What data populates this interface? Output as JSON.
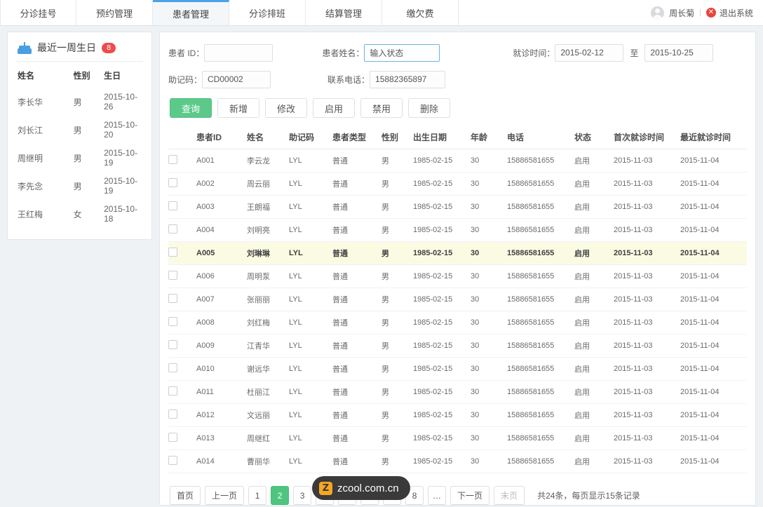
{
  "topbar": {
    "tabs": [
      {
        "label": "分诊挂号",
        "active": false
      },
      {
        "label": "预约管理",
        "active": false
      },
      {
        "label": "患者管理",
        "active": true
      },
      {
        "label": "分诊排班",
        "active": false
      },
      {
        "label": "结算管理",
        "active": false
      },
      {
        "label": "缴欠费",
        "active": false
      }
    ],
    "user_name": "周长菊",
    "divider": "|",
    "logout_label": "退出系统",
    "logout_icon_glyph": "✕",
    "avatar_icon": "user-avatar-icon"
  },
  "sidebar": {
    "title": "最近一周生日",
    "badge": "8",
    "icon": "birthday-cake-icon",
    "columns": [
      "姓名",
      "性别",
      "生日"
    ],
    "rows": [
      {
        "name": "李长华",
        "gender": "男",
        "birthday": "2015-10-26"
      },
      {
        "name": "刘长江",
        "gender": "男",
        "birthday": "2015-10-20"
      },
      {
        "name": "周继明",
        "gender": "男",
        "birthday": "2015-10-19"
      },
      {
        "name": "李先念",
        "gender": "男",
        "birthday": "2015-10-19"
      },
      {
        "name": "王红梅",
        "gender": "女",
        "birthday": "2015-10-18"
      }
    ]
  },
  "search": {
    "patient_id_label": "患者 ID：",
    "patient_id_value": "",
    "patient_id_placeholder": "",
    "patient_name_label": "患者姓名：",
    "patient_name_value": "输入状态",
    "visit_time_label": "就诊时间：",
    "visit_date_from": "2015-02-12",
    "visit_range_sep": "至",
    "visit_date_to": "2015-10-25",
    "mnemonic_label": "助记码：",
    "mnemonic_value": "CD00002",
    "phone_label": "联系电话：",
    "phone_value": "15882365897"
  },
  "actions": {
    "query": "查询",
    "add": "新增",
    "edit": "修改",
    "enable": "启用",
    "disable": "禁用",
    "delete": "删除"
  },
  "table": {
    "columns": [
      "患者ID",
      "姓名",
      "助记码",
      "患者类型",
      "性别",
      "出生日期",
      "年龄",
      "电话",
      "状态",
      "首次就诊时间",
      "最近就诊时间"
    ],
    "rows": [
      {
        "id": "A001",
        "name": "李云龙",
        "mnemonic": "LYL",
        "type": "普通",
        "gender": "男",
        "birth": "1985-02-15",
        "age": "30",
        "phone": "15886581655",
        "status": "启用",
        "first_visit": "2015-11-03",
        "last_visit": "2015-11-04",
        "highlight": false
      },
      {
        "id": "A002",
        "name": "周云丽",
        "mnemonic": "LYL",
        "type": "普通",
        "gender": "男",
        "birth": "1985-02-15",
        "age": "30",
        "phone": "15886581655",
        "status": "启用",
        "first_visit": "2015-11-03",
        "last_visit": "2015-11-04",
        "highlight": false
      },
      {
        "id": "A003",
        "name": "王朗福",
        "mnemonic": "LYL",
        "type": "普通",
        "gender": "男",
        "birth": "1985-02-15",
        "age": "30",
        "phone": "15886581655",
        "status": "启用",
        "first_visit": "2015-11-03",
        "last_visit": "2015-11-04",
        "highlight": false
      },
      {
        "id": "A004",
        "name": "刘明亮",
        "mnemonic": "LYL",
        "type": "普通",
        "gender": "男",
        "birth": "1985-02-15",
        "age": "30",
        "phone": "15886581655",
        "status": "启用",
        "first_visit": "2015-11-03",
        "last_visit": "2015-11-04",
        "highlight": false
      },
      {
        "id": "A005",
        "name": "刘琳琳",
        "mnemonic": "LYL",
        "type": "普通",
        "gender": "男",
        "birth": "1985-02-15",
        "age": "30",
        "phone": "15886581655",
        "status": "启用",
        "first_visit": "2015-11-03",
        "last_visit": "2015-11-04",
        "highlight": true
      },
      {
        "id": "A006",
        "name": "周明泵",
        "mnemonic": "LYL",
        "type": "普通",
        "gender": "男",
        "birth": "1985-02-15",
        "age": "30",
        "phone": "15886581655",
        "status": "启用",
        "first_visit": "2015-11-03",
        "last_visit": "2015-11-04",
        "highlight": false
      },
      {
        "id": "A007",
        "name": "张丽丽",
        "mnemonic": "LYL",
        "type": "普通",
        "gender": "男",
        "birth": "1985-02-15",
        "age": "30",
        "phone": "15886581655",
        "status": "启用",
        "first_visit": "2015-11-03",
        "last_visit": "2015-11-04",
        "highlight": false
      },
      {
        "id": "A008",
        "name": "刘红梅",
        "mnemonic": "LYL",
        "type": "普通",
        "gender": "男",
        "birth": "1985-02-15",
        "age": "30",
        "phone": "15886581655",
        "status": "启用",
        "first_visit": "2015-11-03",
        "last_visit": "2015-11-04",
        "highlight": false
      },
      {
        "id": "A009",
        "name": "江青华",
        "mnemonic": "LYL",
        "type": "普通",
        "gender": "男",
        "birth": "1985-02-15",
        "age": "30",
        "phone": "15886581655",
        "status": "启用",
        "first_visit": "2015-11-03",
        "last_visit": "2015-11-04",
        "highlight": false
      },
      {
        "id": "A010",
        "name": "谢远华",
        "mnemonic": "LYL",
        "type": "普通",
        "gender": "男",
        "birth": "1985-02-15",
        "age": "30",
        "phone": "15886581655",
        "status": "启用",
        "first_visit": "2015-11-03",
        "last_visit": "2015-11-04",
        "highlight": false
      },
      {
        "id": "A011",
        "name": "杜丽江",
        "mnemonic": "LYL",
        "type": "普通",
        "gender": "男",
        "birth": "1985-02-15",
        "age": "30",
        "phone": "15886581655",
        "status": "启用",
        "first_visit": "2015-11-03",
        "last_visit": "2015-11-04",
        "highlight": false
      },
      {
        "id": "A012",
        "name": "文远丽",
        "mnemonic": "LYL",
        "type": "普通",
        "gender": "男",
        "birth": "1985-02-15",
        "age": "30",
        "phone": "15886581655",
        "status": "启用",
        "first_visit": "2015-11-03",
        "last_visit": "2015-11-04",
        "highlight": false
      },
      {
        "id": "A013",
        "name": "周继红",
        "mnemonic": "LYL",
        "type": "普通",
        "gender": "男",
        "birth": "1985-02-15",
        "age": "30",
        "phone": "15886581655",
        "status": "启用",
        "first_visit": "2015-11-03",
        "last_visit": "2015-11-04",
        "highlight": false
      },
      {
        "id": "A014",
        "name": "曹丽华",
        "mnemonic": "LYL",
        "type": "普通",
        "gender": "男",
        "birth": "1985-02-15",
        "age": "30",
        "phone": "15886581655",
        "status": "启用",
        "first_visit": "2015-11-03",
        "last_visit": "2015-11-04",
        "highlight": false
      }
    ]
  },
  "pagination": {
    "first": "首页",
    "prev": "上一页",
    "pages": [
      "1",
      "2",
      "3",
      "4",
      "5",
      "6",
      "7",
      "8"
    ],
    "ellipsis": "…",
    "next": "下一页",
    "last": "末页",
    "active_page": "2",
    "info": "共24条，每页显示15条记录"
  },
  "watermark": {
    "logo_letter": "Z",
    "text": "zcool.com.cn"
  },
  "colors": {
    "accent_green": "#4ec57f",
    "tab_active_blue": "#4aa3e8",
    "badge_red": "#ef4b4b",
    "link_blue": "#4a9ae0",
    "highlight_row": "#fbfbe4",
    "page_bg": "#eef2f5"
  }
}
